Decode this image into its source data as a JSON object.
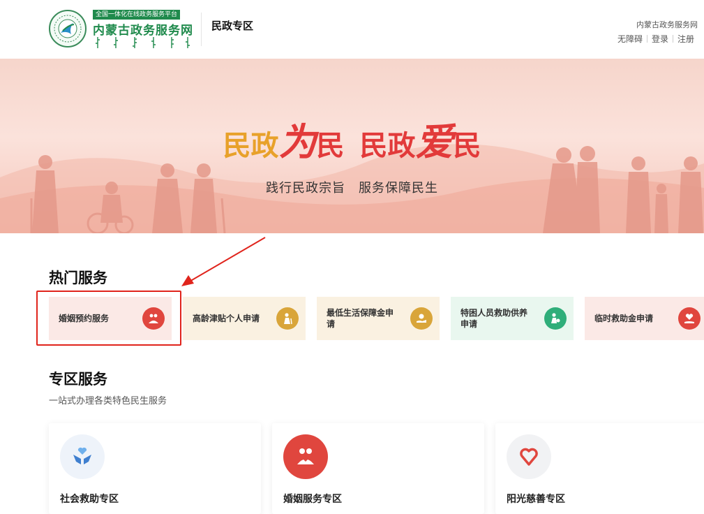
{
  "header": {
    "logo_tag": "全国一体化在线政务服务平台",
    "logo_name": "内蒙古政务服务网",
    "zone_title": "民政专区",
    "site_name": "内蒙古政务服务网",
    "links": {
      "accessibility": "无障碍",
      "login": "登录",
      "register": "注册"
    }
  },
  "banner": {
    "slogan_part1": "民政",
    "slogan_big1": "为",
    "slogan_mid1": "民",
    "slogan_part2": "民政",
    "slogan_big2": "爱",
    "slogan_mid2": "民",
    "subtitle": "践行民政宗旨　服务保障民生"
  },
  "hot_services": {
    "title": "热门服务",
    "items": [
      {
        "label": "婚姻预约服务",
        "icon": "family-icon",
        "bg": "#fbe9e6",
        "icon_color": "#e0463e"
      },
      {
        "label": "高龄津贴个人申请",
        "icon": "elderly-icon",
        "bg": "#faf1e1",
        "icon_color": "#d9a53a"
      },
      {
        "label": "最低生活保障金申请",
        "icon": "hand-coin-icon",
        "bg": "#faf1e1",
        "icon_color": "#d9a53a"
      },
      {
        "label": "特困人员救助供养申请",
        "icon": "person-care-icon",
        "bg": "#e9f7ef",
        "icon_color": "#2fae7a"
      },
      {
        "label": "临时救助金申请",
        "icon": "heart-hand-icon",
        "bg": "#fbe9e6",
        "icon_color": "#e0463e"
      }
    ]
  },
  "zone_services": {
    "title": "专区服务",
    "subtitle": "一站式办理各类特色民生服务",
    "items": [
      {
        "label": "社会救助专区",
        "icon": "hands-heart-icon",
        "icon_bg": "#eef3fa",
        "icon_color": "#3f7fcf"
      },
      {
        "label": "婚姻服务专区",
        "icon": "family-icon",
        "icon_bg": "#e0463e",
        "icon_color": "#ffffff"
      },
      {
        "label": "阳光慈善专区",
        "icon": "ribbon-heart-icon",
        "icon_bg": "#f1f2f4",
        "icon_color": "#e0463e"
      }
    ]
  }
}
